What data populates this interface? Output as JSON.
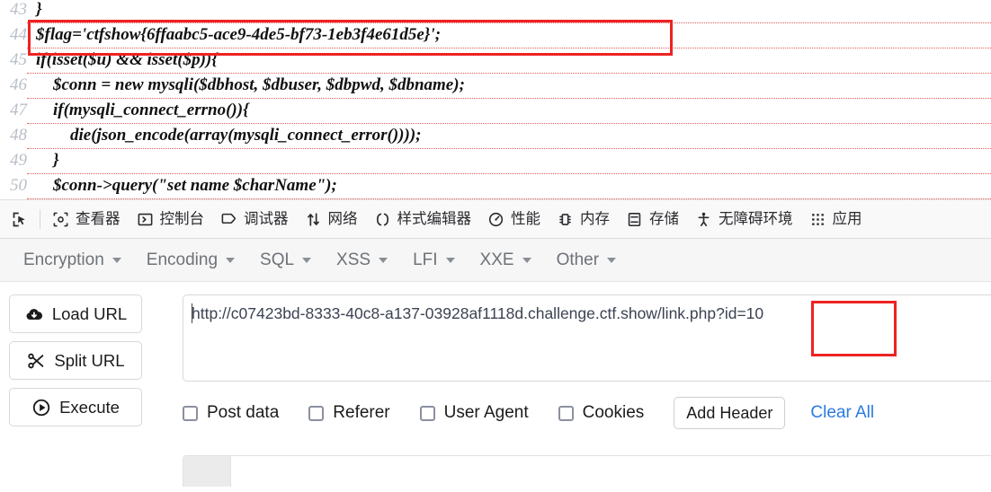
{
  "code_viewer": {
    "lines": [
      {
        "number": "43",
        "text": "}",
        "bold": true
      },
      {
        "number": "44",
        "text": "$flag='ctfshow{6ffaabc5-ace9-4de5-bf73-1eb3f4e61d5e}';",
        "bold": true
      },
      {
        "number": "45",
        "text": "if(isset($u) && isset($p)){",
        "bold": true
      },
      {
        "number": "46",
        "text": "    $conn = new mysqli($dbhost, $dbuser, $dbpwd, $dbname);",
        "bold": true
      },
      {
        "number": "47",
        "text": "    if(mysqli_connect_errno()){",
        "bold": true
      },
      {
        "number": "48",
        "text": "        die(json_encode(array(mysqli_connect_error())));",
        "bold": true
      },
      {
        "number": "49",
        "text": "    }",
        "bold": true
      },
      {
        "number": "50",
        "text": "    $conn->query(\"set name $charName\");",
        "bold": true
      }
    ],
    "highlight_color": "#ee2222",
    "flag_value": "ctfshow{6ffaabc5-ace9-4de5-bf73-1eb3f4e61d5e}"
  },
  "devtools": {
    "picker_icon": "element-picker-icon",
    "tabs": [
      {
        "label": "查看器",
        "icon": "inspector-icon"
      },
      {
        "label": "控制台",
        "icon": "console-icon"
      },
      {
        "label": "调试器",
        "icon": "debugger-icon"
      },
      {
        "label": "网络",
        "icon": "network-icon"
      },
      {
        "label": "样式编辑器",
        "icon": "style-editor-icon"
      },
      {
        "label": "性能",
        "icon": "performance-icon"
      },
      {
        "label": "内存",
        "icon": "memory-icon"
      },
      {
        "label": "存储",
        "icon": "storage-icon"
      },
      {
        "label": "无障碍环境",
        "icon": "accessibility-icon"
      },
      {
        "label": "应用",
        "icon": "application-icon"
      }
    ]
  },
  "hackbar": {
    "menus": [
      {
        "label": "Encryption"
      },
      {
        "label": "Encoding"
      },
      {
        "label": "SQL"
      },
      {
        "label": "XSS"
      },
      {
        "label": "LFI"
      },
      {
        "label": "XXE"
      },
      {
        "label": "Other"
      }
    ],
    "actions": [
      {
        "label": "Load URL",
        "icon": "cloud-download-icon"
      },
      {
        "label": "Split URL",
        "icon": "scissors-icon"
      },
      {
        "label": "Execute",
        "icon": "play-circle-icon"
      }
    ],
    "url_field": {
      "value": "http://c07423bd-8333-40c8-a137-03928af1118d.challenge.ctf.show/link.php?id=10",
      "placeholder": "",
      "highlighted_fragment": "?id=10"
    },
    "options": [
      {
        "label": "Post data",
        "checked": false
      },
      {
        "label": "Referer",
        "checked": false
      },
      {
        "label": "User Agent",
        "checked": false
      },
      {
        "label": "Cookies",
        "checked": false
      }
    ],
    "add_header_label": "Add Header",
    "clear_all_label": "Clear All",
    "link_color": "#2a7ae2"
  }
}
